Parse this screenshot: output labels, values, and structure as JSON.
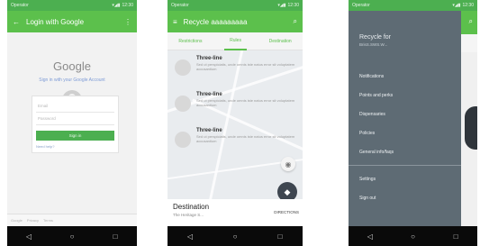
{
  "phone1": {
    "status": {
      "carrier": "Operator",
      "time": "12:30"
    },
    "appbar": {
      "title": "Login with Google"
    },
    "google": {
      "logo": "Google",
      "subtitle": "Sign in with your Google Account"
    },
    "form": {
      "email_placeholder": "Email",
      "password_placeholder": "Password",
      "signin_label": "Sign in",
      "help_link": "Need help?"
    },
    "footer": {
      "items": [
        "Google",
        "Privacy",
        "Terms"
      ]
    }
  },
  "phone2": {
    "status": {
      "carrier": "Operator",
      "time": "12:30"
    },
    "appbar": {
      "title": "Recycle aaaaaaaaa"
    },
    "tabs": [
      "Restrictions",
      "Rules",
      "Destination"
    ],
    "list": [
      {
        "title": "Three-line",
        "body": "Sed ut perspiciatis, unde omnis iste natus error sit voluptatem accusantium"
      },
      {
        "title": "Three-line",
        "body": "Sed ut perspiciatis, unde omnis iste natus error sit voluptatem accusantium"
      },
      {
        "title": "Three-line",
        "body": "Sed ut perspiciatis, unde omnis iste natus error sit voluptatem accusantium"
      }
    ],
    "destination": {
      "title": "Destination",
      "subtitle": "The Heritage S...",
      "directions_label": "DIRECTIONS"
    }
  },
  "phone3": {
    "status": {
      "carrier": "Operator",
      "time": "12:30"
    },
    "drawer": {
      "title": "Recycle for",
      "subtitle": "BrisS.SWS.W...",
      "items": [
        "Notifications",
        "Points and perks",
        "Dispensaries",
        "Policies",
        "General info/faqs"
      ],
      "bottom_items": [
        "Settings",
        "Sign out"
      ]
    }
  },
  "icons": {
    "back": "arrow-back-icon",
    "menu": "hamburger-icon",
    "more": "more-vert-icon",
    "search": "search-icon"
  },
  "colors": {
    "primary": "#5cc04c",
    "status": "#4caf50",
    "drawer": "#5e6b74",
    "fab": "#3e4650"
  }
}
